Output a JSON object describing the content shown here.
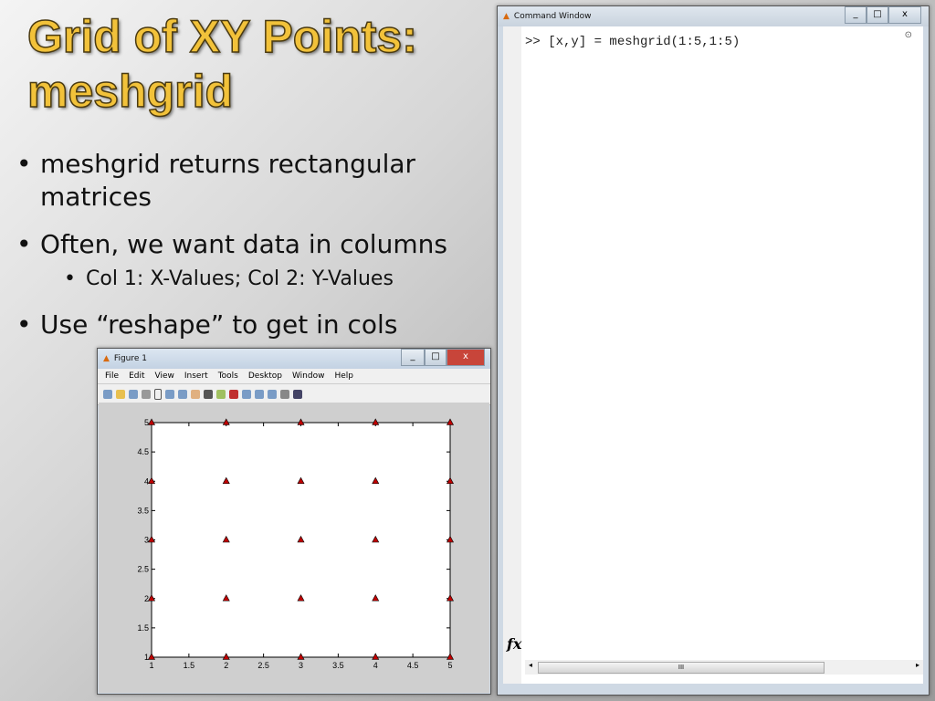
{
  "slide": {
    "title_line1": "Grid of XY Points:",
    "title_line2": "meshgrid",
    "bullets": [
      "meshgrid returns rectangular matrices",
      "Often, we want data in columns",
      "Use “reshape” to get in cols"
    ],
    "sub_bullet": "Col 1: X-Values; Col 2: Y-Values",
    "bullet_char": "•"
  },
  "command_window": {
    "title": "Command Window",
    "prompt": ">>",
    "command": "[x,y] = meshgrid(1:5,1:5)",
    "fx": "fx",
    "scroll_grip": "III"
  },
  "figure": {
    "title": "Figure 1",
    "menu": [
      "File",
      "Edit",
      "View",
      "Insert",
      "Tools",
      "Desktop",
      "Window",
      "Help"
    ]
  },
  "chart_data": {
    "type": "scatter",
    "marker": "triangle",
    "color": "#c00000",
    "x": [
      1,
      2,
      3,
      4,
      5,
      1,
      2,
      3,
      4,
      5,
      1,
      2,
      3,
      4,
      5,
      1,
      2,
      3,
      4,
      5,
      1,
      2,
      3,
      4,
      5
    ],
    "y": [
      1,
      1,
      1,
      1,
      1,
      2,
      2,
      2,
      2,
      2,
      3,
      3,
      3,
      3,
      3,
      4,
      4,
      4,
      4,
      4,
      5,
      5,
      5,
      5,
      5
    ],
    "xlim": [
      1,
      5
    ],
    "ylim": [
      1,
      5
    ],
    "xticks": [
      "1",
      "1.5",
      "2",
      "2.5",
      "3",
      "3.5",
      "4",
      "4.5",
      "5"
    ],
    "yticks": [
      "1",
      "1.5",
      "2",
      "2.5",
      "3",
      "3.5",
      "4",
      "4.5",
      "5"
    ],
    "grid": false,
    "title": "",
    "xlabel": "",
    "ylabel": ""
  }
}
